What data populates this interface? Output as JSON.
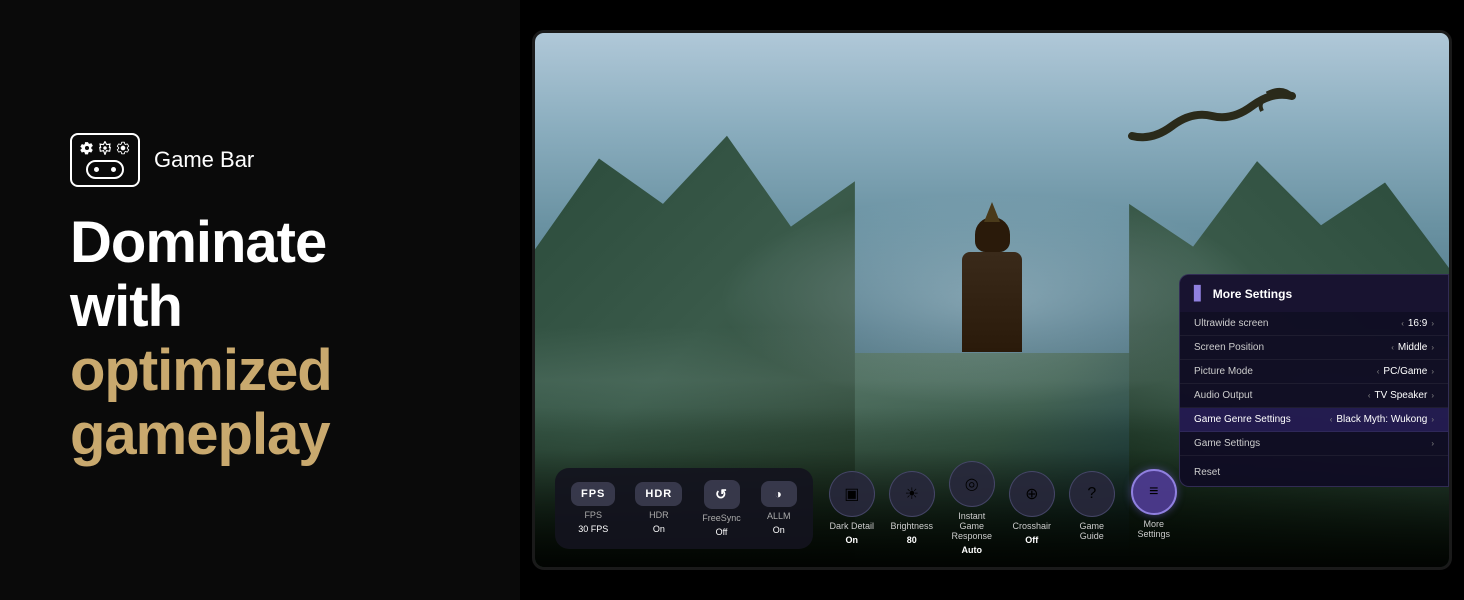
{
  "left": {
    "feature_label": "Game Bar",
    "headline_line1": "Dominate with",
    "headline_line2": "optimized",
    "headline_line3": "gameplay"
  },
  "gamebar": {
    "stats": [
      {
        "badge": "FPS",
        "label": "FPS",
        "value": "30 FPS"
      },
      {
        "badge": "HDR",
        "label": "HDR",
        "value": "On"
      },
      {
        "badge": "↺",
        "label": "FreeSync",
        "value": "Off"
      },
      {
        "badge": "◑",
        "label": "ALLM",
        "value": "On"
      }
    ],
    "controls": [
      {
        "icon": "▣",
        "label": "Dark Detail",
        "value": "On"
      },
      {
        "icon": "⚙",
        "label": "Brightness",
        "value": "80"
      },
      {
        "icon": "◎",
        "label": "Instant Game Response",
        "value": "Auto"
      },
      {
        "icon": "⊕",
        "label": "Crosshair",
        "value": "Off"
      },
      {
        "icon": "?",
        "label": "Game Guide",
        "value": ""
      }
    ],
    "more_settings_label": "More Settings"
  },
  "settings_panel": {
    "title": "More Settings",
    "rows": [
      {
        "label": "Ultrawide screen",
        "value": "16:9",
        "highlighted": false
      },
      {
        "label": "Screen Position",
        "value": "Middle",
        "highlighted": false
      },
      {
        "label": "Picture Mode",
        "value": "PC/Game",
        "highlighted": false
      },
      {
        "label": "Audio Output",
        "value": "TV Speaker",
        "highlighted": false
      },
      {
        "label": "Game Genre Settings",
        "value": "Black Myth: Wukong",
        "highlighted": true
      },
      {
        "label": "Game Settings",
        "value": "",
        "highlighted": false
      },
      {
        "label": "Reset",
        "value": "",
        "highlighted": false
      }
    ]
  }
}
